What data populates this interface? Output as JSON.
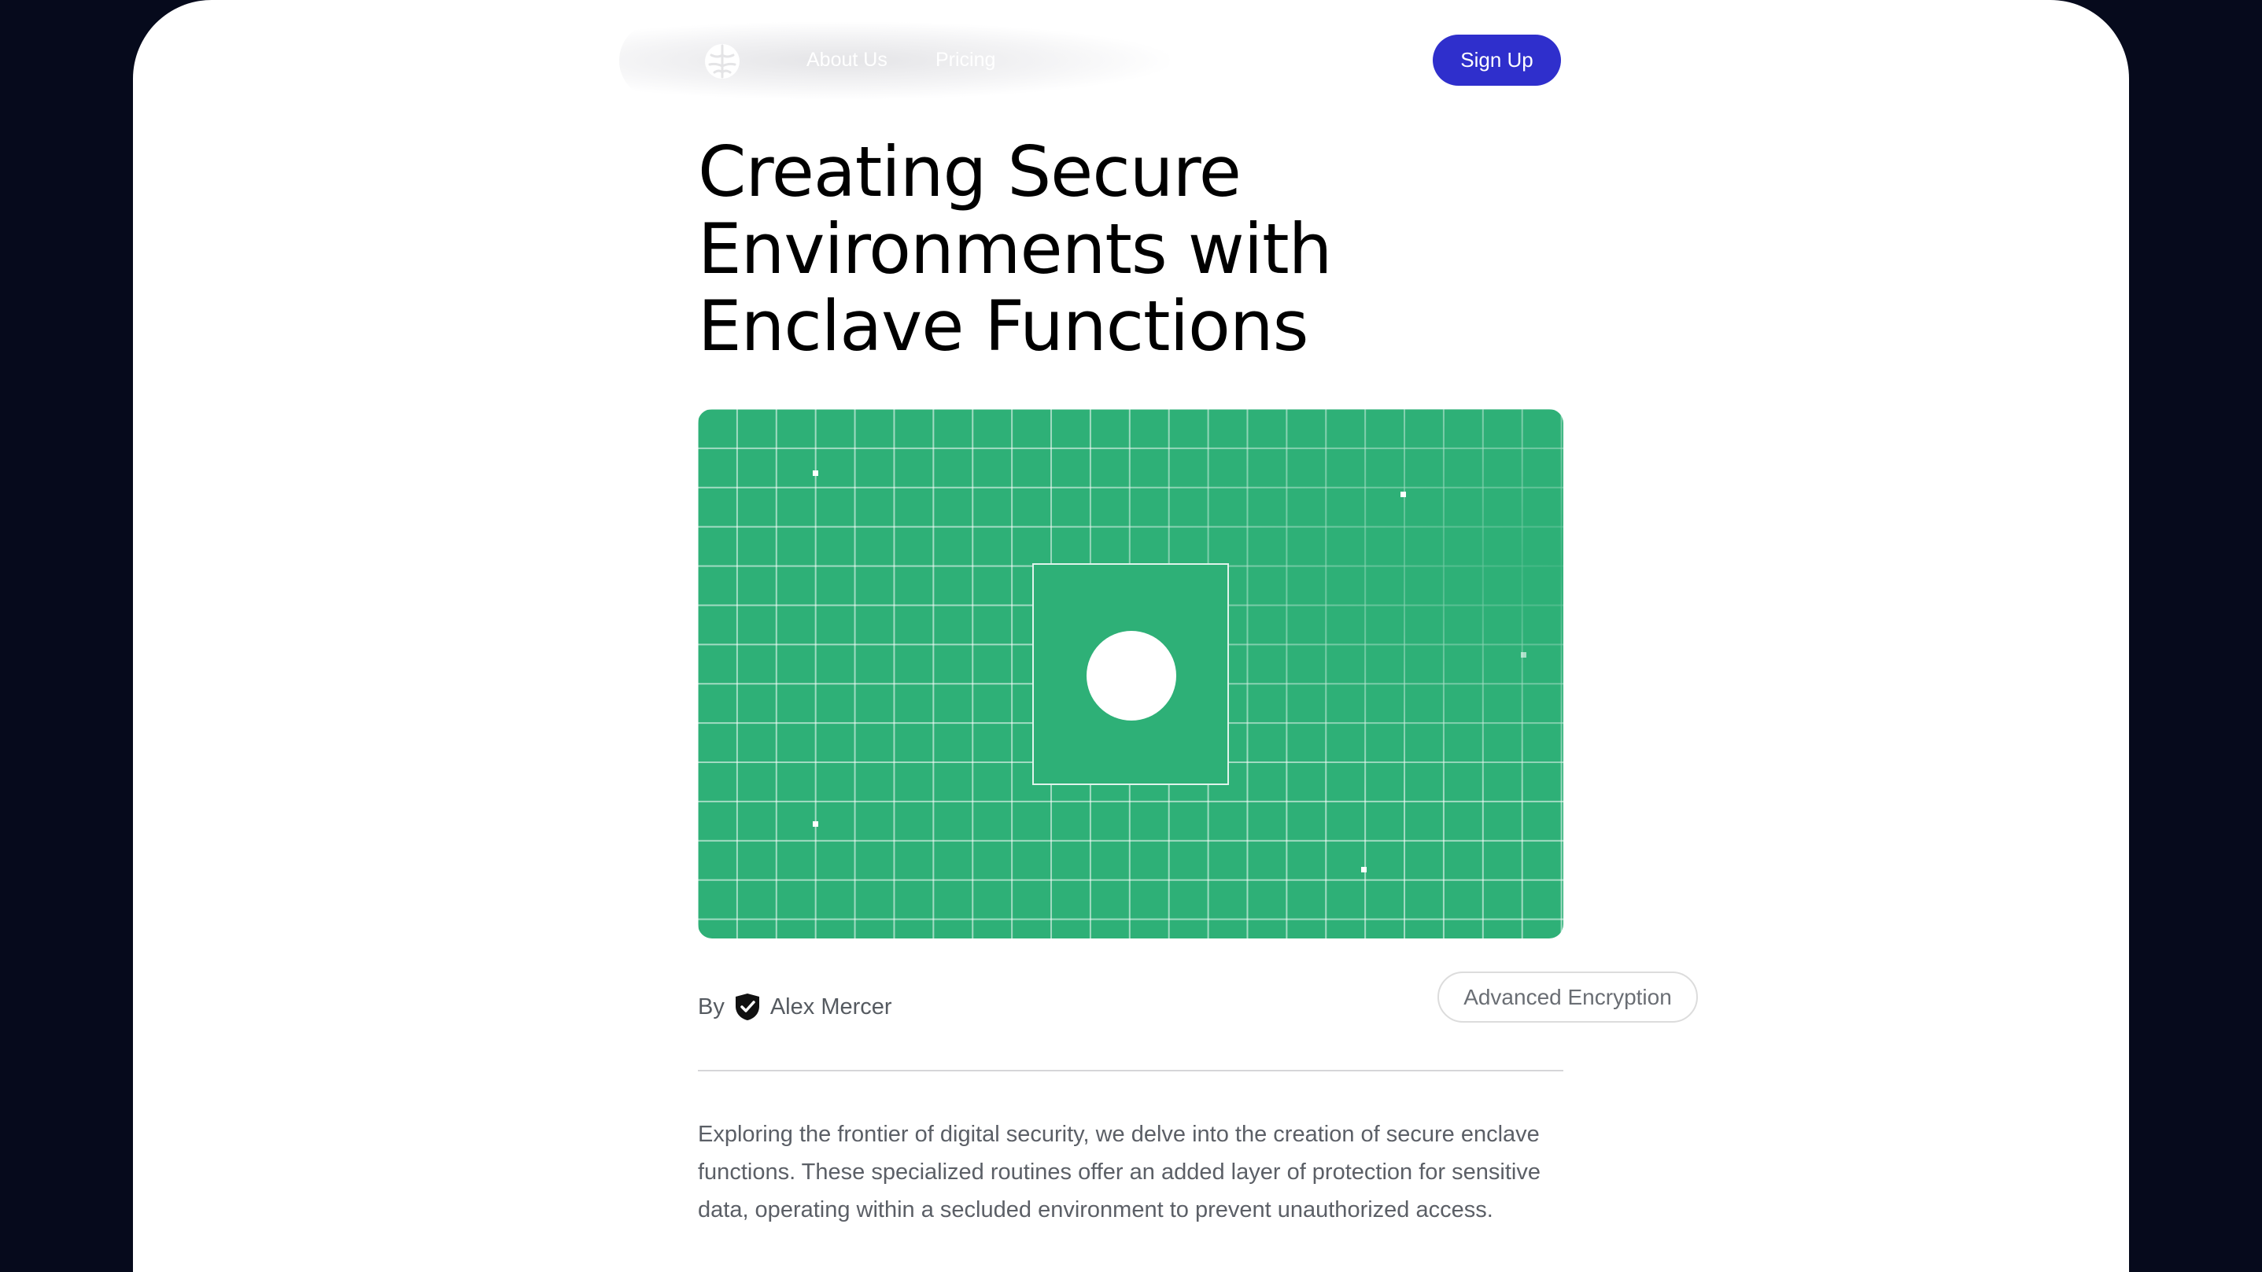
{
  "nav": {
    "logo_icon": "brain-logo-icon",
    "links": [
      {
        "label": "About Us"
      },
      {
        "label": "Pricing"
      }
    ],
    "signup_label": "Sign Up"
  },
  "article": {
    "title": "Creating Secure Environments with Enclave Functions",
    "byline_prefix": "By",
    "author_icon": "shield-check-icon",
    "author": "Alex Mercer",
    "tag": "Advanced Encryption",
    "intro": "Exploring the frontier of digital security, we delve into the creation of secure enclave functions. These specialized routines offer an added layer of protection for sensitive data, operating within a secluded environment to prevent unauthorized access."
  },
  "colors": {
    "page_background": "#060a1c",
    "accent_button": "#2f2fcc",
    "hero_green": "#2eb077"
  }
}
